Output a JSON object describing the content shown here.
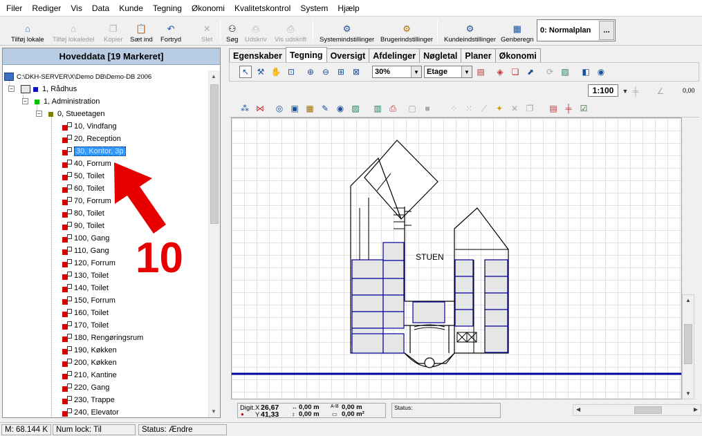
{
  "menu": [
    "Filer",
    "Rediger",
    "Vis",
    "Data",
    "Kunde",
    "Tegning",
    "Økonomi",
    "Kvalitetskontrol",
    "System",
    "Hjælp"
  ],
  "toolbar": [
    {
      "label": "Tilføj lokale",
      "icon": "add-room-icon",
      "glyph": "⌂",
      "enabled": true
    },
    {
      "label": "Tilføj lokaledel",
      "icon": "add-room-part-icon",
      "glyph": "⌂",
      "enabled": false
    },
    {
      "label": "Kopier",
      "icon": "copy-icon",
      "glyph": "❐",
      "enabled": false
    },
    {
      "label": "Sæt ind",
      "icon": "paste-icon",
      "glyph": "📋",
      "enabled": true
    },
    {
      "label": "Fortryd",
      "icon": "undo-icon",
      "glyph": "↶",
      "enabled": true
    },
    {
      "label": "Slet",
      "icon": "delete-icon",
      "glyph": "✕",
      "enabled": false
    },
    {
      "label": "Søg",
      "icon": "binoculars-icon",
      "glyph": "⚇",
      "enabled": true
    },
    {
      "label": "Udskriv",
      "icon": "print-icon",
      "glyph": "⎙",
      "enabled": false
    },
    {
      "label": "Vis udskrift",
      "icon": "print-preview-icon",
      "glyph": "⎙",
      "enabled": false
    },
    {
      "label": "Systemindstillinger",
      "icon": "system-settings-icon",
      "glyph": "⚙",
      "enabled": true
    },
    {
      "label": "Brugerindstillinger",
      "icon": "user-settings-icon",
      "glyph": "⚙",
      "enabled": true
    },
    {
      "label": "Kundeindstillinger",
      "icon": "customer-settings-icon",
      "glyph": "⚙",
      "enabled": true
    },
    {
      "label": "Genberegn",
      "icon": "recalculate-icon",
      "glyph": "▦",
      "enabled": true
    }
  ],
  "plan_selector": {
    "value": "0: Normalplan",
    "button": "..."
  },
  "left_panel": {
    "title": "Hoveddata  [19 Markeret]",
    "root": "C:\\DKH-SERVER\\X\\Demo DB\\Demo-DB 2006",
    "building": "1, Rådhus",
    "department": "1, Administration",
    "floor": "0, Stueetagen",
    "selected_room": "30, Kontor, 3p",
    "rooms_before": [
      "10, Vindfang",
      "20, Reception"
    ],
    "rooms_after": [
      "40, Forrum",
      "50, Toilet",
      "60, Toilet",
      "70, Forrum",
      "80, Toilet",
      "90, Toilet",
      "100, Gang",
      "110, Gang",
      "120, Forrum",
      "130, Toilet",
      "140, Toilet",
      "150, Forrum",
      "160, Toilet",
      "170, Toilet",
      "180, Rengøringsrum",
      "190, Køkken",
      "200, Køkken",
      "210, Kantine",
      "220, Gang",
      "230, Trappe",
      "240, Elevator"
    ]
  },
  "annotation": {
    "number": "10",
    "color": "#e60000"
  },
  "tabs": [
    "Egenskaber",
    "Tegning",
    "Oversigt",
    "Afdelinger",
    "Nøgletal",
    "Planer",
    "Økonomi"
  ],
  "active_tab": "Tegning",
  "drawing": {
    "zoom": "30%",
    "layer": "Etage",
    "scale": "1:100",
    "angle_value": "0,00",
    "floor_label": "STUEN"
  },
  "readout": {
    "digit_label": "Digit.",
    "x_label": "X",
    "x": "26,67",
    "y_label": "Y",
    "y": "41,33",
    "len1": "0,00 m",
    "len2": "0,00 m",
    "ab_label": "A-B",
    "ab": "0,00 m",
    "area": "0,00 m²",
    "status_label": "Status:"
  },
  "statusbar": {
    "memory": "M: 68.144 K",
    "numlock": "Num lock: Til",
    "status": "Status: Ændre"
  },
  "colors": {
    "header_blue": "#b8cce4",
    "selection": "#3399ff",
    "plan_blue": "#0000a0",
    "red_marker": "#d40000"
  }
}
